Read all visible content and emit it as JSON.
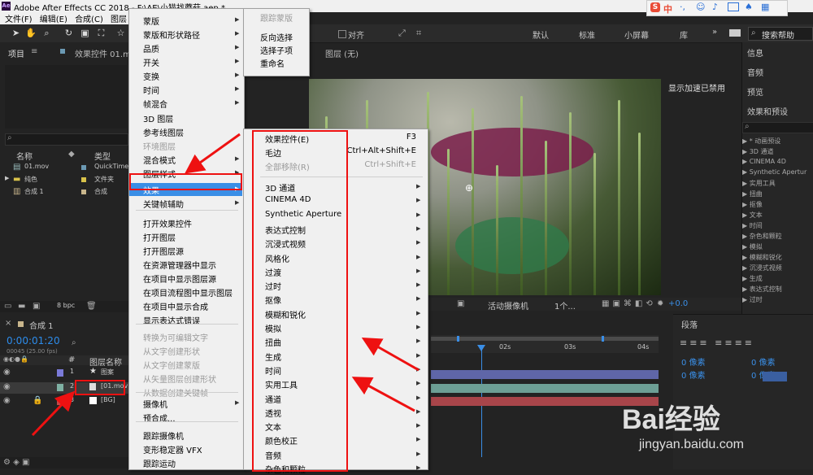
{
  "app": {
    "title": "Adobe After Effects CC 2018 - F:\\AE\\小猫找蘑菇.aep *",
    "logo": "Ae"
  },
  "menubar": {
    "items": [
      "文件(F)",
      "编辑(E)",
      "合成(C)",
      "图层(L)"
    ]
  },
  "toolbar": {
    "align_label": "对齐",
    "workspaces": [
      "默认",
      "标准",
      "小屏幕",
      "库"
    ],
    "search_help": "搜索帮助"
  },
  "ime": {
    "label": "中"
  },
  "project_panel": {
    "tab_project": "项目",
    "tab_effect_controls": "效果控件 01.mov",
    "col_name": "名称",
    "col_type": "类型",
    "items": [
      {
        "name": "01.mov",
        "type": "QuickTime",
        "color": "#6b99b3"
      },
      {
        "name": "纯色",
        "type": "文件夹",
        "color": "#d8c24a"
      },
      {
        "name": "合成 1",
        "type": "合成",
        "color": "#c9b68c"
      }
    ],
    "bpc": "8 bpc"
  },
  "layer_panel": {
    "tab": "图层 (无)"
  },
  "comp_viewer": {
    "gpu_notice": "显示加速已禁用",
    "camera": "活动摄像机",
    "views": "1个...",
    "exposure": "+0.0"
  },
  "timeline": {
    "comp_tab": "合成 1",
    "timecode": "0:00:01:20",
    "fps": "00045 (25.00 fps)",
    "col_num": "#",
    "col_layer_name": "图层名称",
    "ticks": [
      "02s",
      "03s",
      "04s"
    ],
    "layers": [
      {
        "num": "1",
        "name": "图案",
        "color": "#7a7ad8"
      },
      {
        "num": "2",
        "name": "[01.mov]",
        "color": "#7fb1a4"
      },
      {
        "num": "3",
        "name": "[BG]",
        "color": "#c24a4a"
      }
    ]
  },
  "context_menu": {
    "items": [
      {
        "label": "蒙版",
        "sub": true,
        "disabled": false
      },
      {
        "label": "蒙版和形状路径",
        "sub": true,
        "disabled": false
      },
      {
        "label": "品质",
        "sub": true,
        "disabled": false
      },
      {
        "label": "开关",
        "sub": true,
        "disabled": false
      },
      {
        "label": "变换",
        "sub": true,
        "disabled": false
      },
      {
        "label": "时间",
        "sub": true,
        "disabled": false
      },
      {
        "label": "帧混合",
        "sub": true,
        "disabled": false
      },
      {
        "label": "3D 图层",
        "sub": false,
        "disabled": false
      },
      {
        "label": "参考线图层",
        "sub": false,
        "disabled": false
      },
      {
        "label": "环境图层",
        "sub": false,
        "disabled": true
      },
      {
        "label": "混合模式",
        "sub": true,
        "disabled": false
      },
      {
        "label": "图层样式",
        "sub": true,
        "disabled": false
      },
      {
        "label": "效果",
        "sub": true,
        "disabled": false,
        "highlight": true
      },
      {
        "label": "关键帧辅助",
        "sub": true,
        "disabled": false
      },
      {
        "label": "打开效果控件",
        "sub": false,
        "disabled": false
      },
      {
        "label": "打开图层",
        "sub": false,
        "disabled": false
      },
      {
        "label": "打开图层源",
        "sub": false,
        "disabled": false
      },
      {
        "label": "在资源管理器中显示",
        "sub": false,
        "disabled": false
      },
      {
        "label": "在项目中显示图层源",
        "sub": false,
        "disabled": false
      },
      {
        "label": "在项目流程图中显示图层",
        "sub": false,
        "disabled": false
      },
      {
        "label": "在项目中显示合成",
        "sub": false,
        "disabled": false
      },
      {
        "label": "显示表达式错误",
        "sub": false,
        "disabled": false
      },
      {
        "label": "转换为可编辑文字",
        "sub": false,
        "disabled": true
      },
      {
        "label": "从文字创建形状",
        "sub": false,
        "disabled": true
      },
      {
        "label": "从文字创建蒙版",
        "sub": false,
        "disabled": true
      },
      {
        "label": "从矢量图层创建形状",
        "sub": false,
        "disabled": true
      },
      {
        "label": "从数据创建关键帧",
        "sub": false,
        "disabled": true
      },
      {
        "label": "摄像机",
        "sub": true,
        "disabled": false
      },
      {
        "label": "预合成...",
        "sub": false,
        "disabled": false
      },
      {
        "label": "跟踪摄像机",
        "sub": false,
        "disabled": false
      },
      {
        "label": "变形稳定器 VFX",
        "sub": false,
        "disabled": false
      },
      {
        "label": "跟踪运动",
        "sub": false,
        "disabled": false
      }
    ]
  },
  "mask_submenu": {
    "header": "跟踪蒙版",
    "items": [
      "反向选择",
      "选择子项",
      "重命名"
    ]
  },
  "effect_submenu": {
    "top": [
      {
        "label": "效果控件(E)",
        "shortcut": "F3",
        "disabled": false
      },
      {
        "label": "毛边",
        "shortcut": "Ctrl+Alt+Shift+E",
        "disabled": false
      },
      {
        "label": "全部移除(R)",
        "shortcut": "Ctrl+Shift+E",
        "disabled": true
      }
    ],
    "categories": [
      "3D 通道",
      "CINEMA 4D",
      "Synthetic Aperture",
      "表达式控制",
      "沉浸式视频",
      "风格化",
      "过渡",
      "过时",
      "抠像",
      "模糊和锐化",
      "模拟",
      "扭曲",
      "生成",
      "时间",
      "实用工具",
      "通道",
      "透视",
      "文本",
      "颜色校正",
      "音频",
      "杂色和颗粒"
    ]
  },
  "right_panel": {
    "items": [
      "信息",
      "音频",
      "预览",
      "效果和预设"
    ],
    "effects": [
      "* 动画预设",
      "3D 通道",
      "CINEMA 4D",
      "Synthetic Apertur",
      "实用工具",
      "扭曲",
      "抠像",
      "文本",
      "时间",
      "杂色和颗粒",
      "模拟",
      "模糊和锐化",
      "沉浸式视频",
      "生成",
      "表达式控制",
      "过时"
    ],
    "paragraph_tab": "段落",
    "pixel_label": "0 像素"
  },
  "watermark": {
    "brand": "Bai经验",
    "url": "jingyan.baidu.com"
  },
  "colors": {
    "highlight": "#3a8ee6",
    "annotation": "#e11111",
    "timecode": "#2d8ceb"
  }
}
